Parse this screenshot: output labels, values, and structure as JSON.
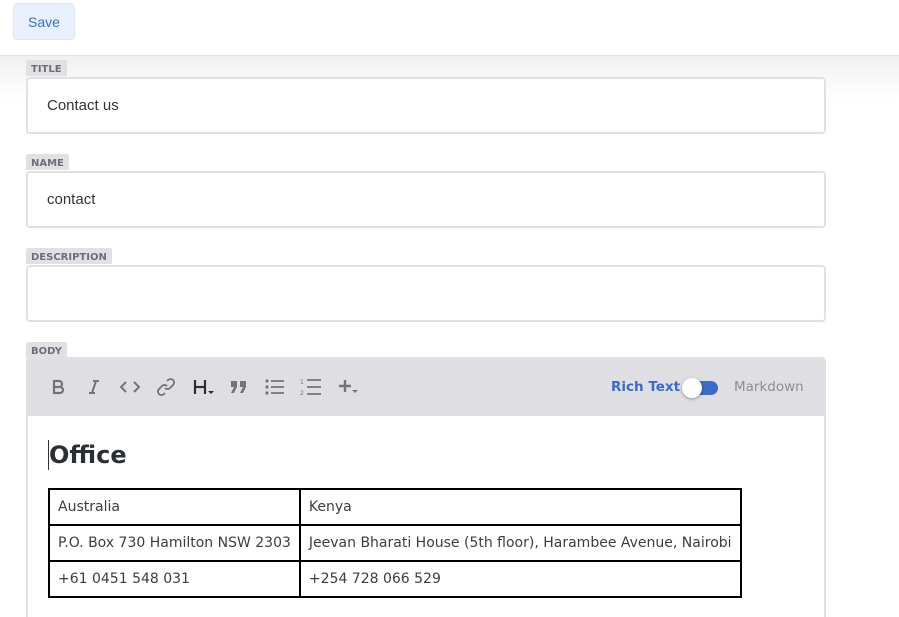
{
  "topbar": {
    "save_label": "Save"
  },
  "fields": {
    "title": {
      "label": "TITLE",
      "value": "Contact us"
    },
    "name": {
      "label": "NAME",
      "value": "contact"
    },
    "description": {
      "label": "DESCRIPTION",
      "value": ""
    },
    "body": {
      "label": "BODY"
    }
  },
  "editor": {
    "toolbar": {
      "buttons": [
        "bold-icon",
        "italic-icon",
        "code-icon",
        "link-icon",
        "heading-icon",
        "quote-icon",
        "bulleted-list-icon",
        "numbered-list-icon",
        "add-icon"
      ],
      "rich_text_label": "Rich Text",
      "markdown_label": "Markdown",
      "mode": "Rich Text"
    },
    "heading": "Office",
    "table": {
      "rows": [
        [
          "Australia",
          "Kenya"
        ],
        [
          "P.O. Box 730 Hamilton NSW 2303",
          "Jeevan Bharati House (5th floor), Harambee Avenue, Nairobi"
        ],
        [
          "+61 0451 548 031",
          "+254 728 066 529"
        ]
      ]
    }
  },
  "colors": {
    "accent": "#3a6cc7",
    "save_bg": "#e8f1fb",
    "label_bg": "#e1e1e5",
    "toolbar_bg": "#dfdfe3"
  }
}
